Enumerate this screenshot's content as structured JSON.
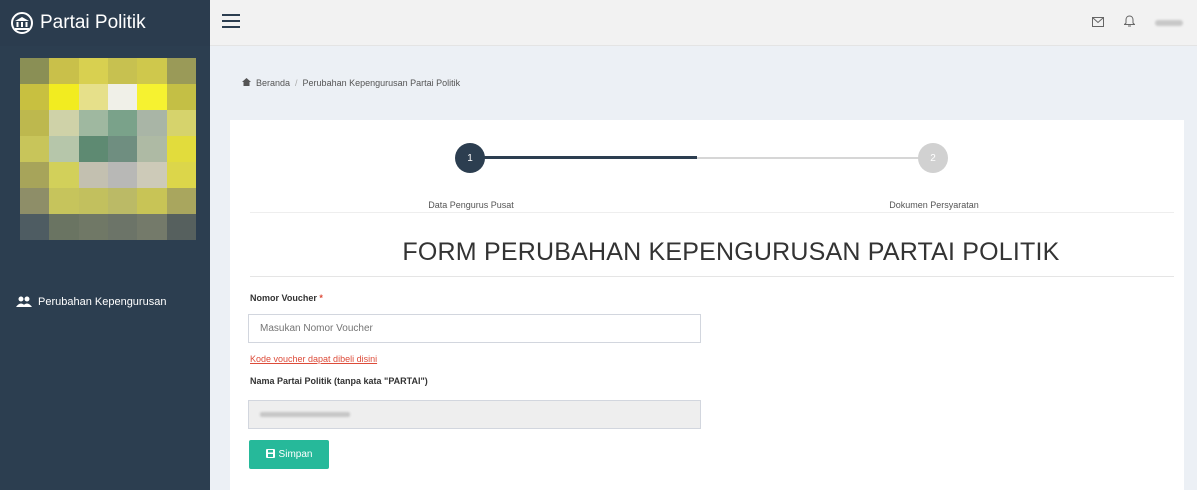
{
  "app": {
    "title": "Partai Politik",
    "logo_icon": "bank-building-icon"
  },
  "sidebar": {
    "items": [
      {
        "label": "Perubahan Kepengurusan",
        "icon": "users-icon"
      }
    ]
  },
  "topbar": {
    "icons": [
      "hamburger-menu-icon",
      "envelope-icon",
      "bell-icon"
    ]
  },
  "breadcrumb": {
    "home": "Beranda",
    "current": "Perubahan Kepengurusan Partai Politik"
  },
  "stepper": {
    "steps": [
      {
        "number": "1",
        "label": "Data Pengurus Pusat",
        "state": "active"
      },
      {
        "number": "2",
        "label": "Dokumen Persyaratan",
        "state": "pending"
      }
    ]
  },
  "form": {
    "title": "FORM PERUBAHAN KEPENGURUSAN PARTAI POLITIK",
    "voucher_label": "Nomor Voucher",
    "required_marker": "*",
    "voucher_placeholder": "Masukan Nomor Voucher",
    "voucher_link": "Kode voucher dapat dibeli disini",
    "partai_label": "Nama Partai Politik (tanpa kata \"PARTAI\")",
    "save_label": "Simpan"
  },
  "colors": {
    "sidebar": "#2c3e50",
    "step_active": "#2c3e50",
    "step_pending": "#d1d1d1",
    "link": "#dd4b39",
    "save_button": "#26b99a"
  }
}
